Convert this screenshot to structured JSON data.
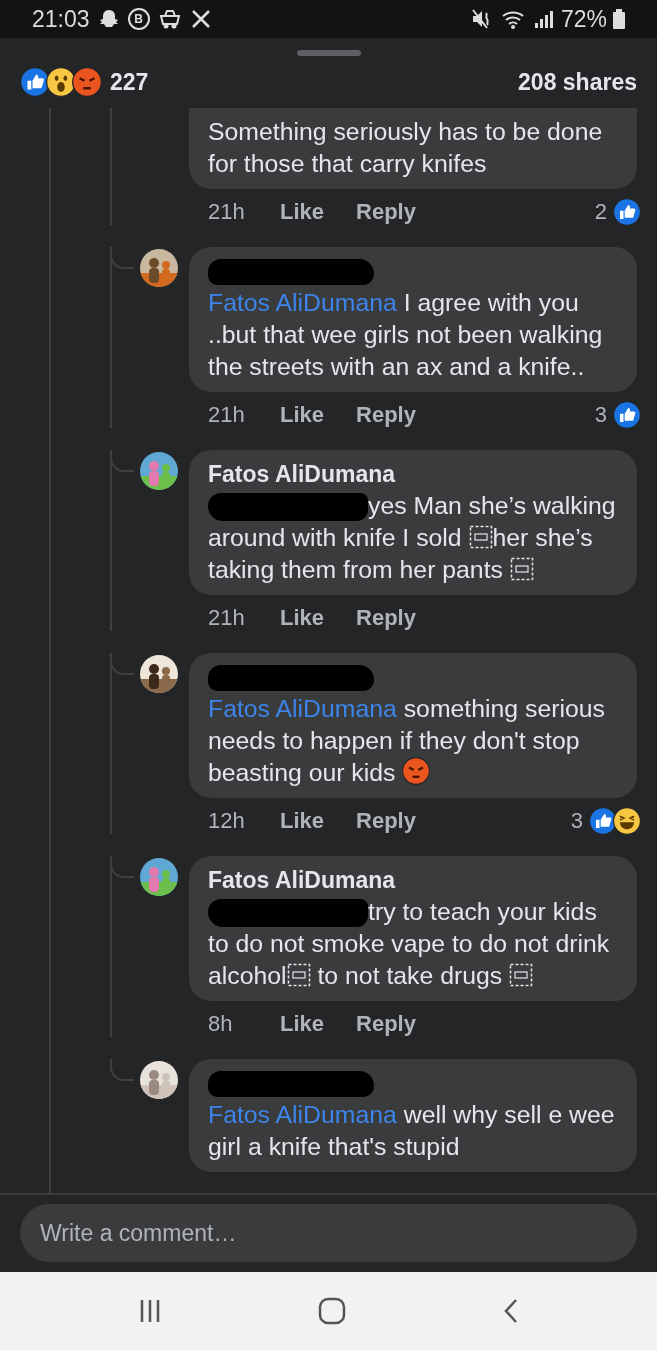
{
  "status_bar": {
    "time": "21:03",
    "notification_badge": "B",
    "battery": "72%"
  },
  "summary": {
    "reactions": [
      {
        "kind": "like"
      },
      {
        "kind": "wow"
      },
      {
        "kind": "angry"
      }
    ],
    "count": "227",
    "shares": "208 shares"
  },
  "comments": [
    {
      "kind": "continued",
      "segments": [
        "Something seriously has to be done for those that carry knifes"
      ],
      "time": "21h",
      "actions": [
        "Like",
        "Reply"
      ],
      "reaction_count": "2",
      "reactions": [
        {
          "kind": "like"
        }
      ]
    },
    {
      "kind": "reply",
      "avatar": {
        "kind": "picture"
      },
      "redaction": {
        "kind": "name"
      },
      "mention": "Fatos AliDumana",
      "segments": [
        " I agree with you ..but that wee girls not been walking the streets with an ax and a knife.."
      ],
      "time": "21h",
      "actions": [
        "Like",
        "Reply"
      ],
      "reaction_count": "3",
      "reactions": [
        {
          "kind": "like"
        }
      ]
    },
    {
      "kind": "reply",
      "avatar": {
        "kind": "picture"
      },
      "author": "Fatos AliDumana",
      "redaction": {
        "kind": "inline"
      },
      "segments": [
        "yes Man she’s walking around with knife  I sold ",
        {
          "kind": "object"
        },
        "her she’s taking them from her pants ",
        {
          "kind": "object"
        }
      ],
      "time": "21h",
      "actions": [
        "Like",
        "Reply"
      ]
    },
    {
      "kind": "reply",
      "avatar": {
        "kind": "picture"
      },
      "redaction": {
        "kind": "name"
      },
      "mention": "Fatos AliDumana",
      "segments": [
        " something serious needs to happen if they don't stop beasting our kids ",
        {
          "kind": "angry"
        }
      ],
      "time": "12h",
      "actions": [
        "Like",
        "Reply"
      ],
      "reaction_count": "3",
      "reactions": [
        {
          "kind": "like"
        },
        {
          "kind": "haha"
        }
      ]
    },
    {
      "kind": "reply",
      "avatar": {
        "kind": "picture"
      },
      "author": "Fatos AliDumana",
      "redaction": {
        "kind": "inline"
      },
      "segments": [
        "try to teach your kids to do not smoke vape to do not drink alcohol",
        {
          "kind": "object"
        },
        " to not take drugs ",
        {
          "kind": "object"
        }
      ],
      "time": "8h",
      "actions": [
        "Like",
        "Reply"
      ]
    },
    {
      "kind": "reply",
      "avatar": {
        "kind": "picture"
      },
      "redaction": {
        "kind": "name"
      },
      "mention": "Fatos AliDumana",
      "segments": [
        " well why sell e wee girl a knife that's stupid"
      ]
    }
  ],
  "composer": {
    "placeholder": "Write a comment…"
  }
}
